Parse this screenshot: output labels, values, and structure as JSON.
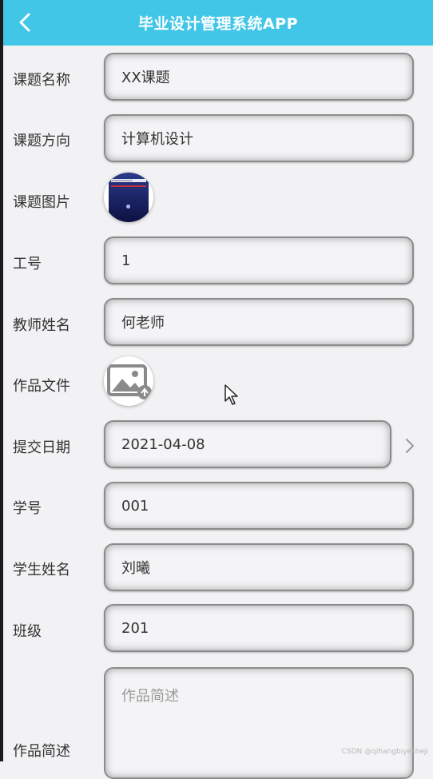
{
  "header": {
    "title": "毕业设计管理系统APP",
    "back_icon": "chevron-left-icon",
    "background": "#42c6e8"
  },
  "form": {
    "topic_name": {
      "label": "课题名称",
      "value": "XX课题"
    },
    "topic_direction": {
      "label": "课题方向",
      "value": "计算机设计"
    },
    "topic_image": {
      "label": "课题图片",
      "thumb_text": "XXXXXXXXXXXXX"
    },
    "staff_id": {
      "label": "工号",
      "value": "1"
    },
    "teacher_name": {
      "label": "教师姓名",
      "value": "何老师"
    },
    "work_file": {
      "label": "作品文件",
      "icon": "image-upload-icon"
    },
    "submit_date": {
      "label": "提交日期",
      "value": "2021-04-08",
      "icon": "chevron-right-icon"
    },
    "student_id": {
      "label": "学号",
      "value": "001"
    },
    "student_name": {
      "label": "学生姓名",
      "value": "刘曦"
    },
    "class": {
      "label": "班级",
      "value": "201"
    },
    "work_description": {
      "label": "作品简述",
      "placeholder": "作品简述"
    }
  },
  "watermark": "CSDN @qihangbiyesheji"
}
